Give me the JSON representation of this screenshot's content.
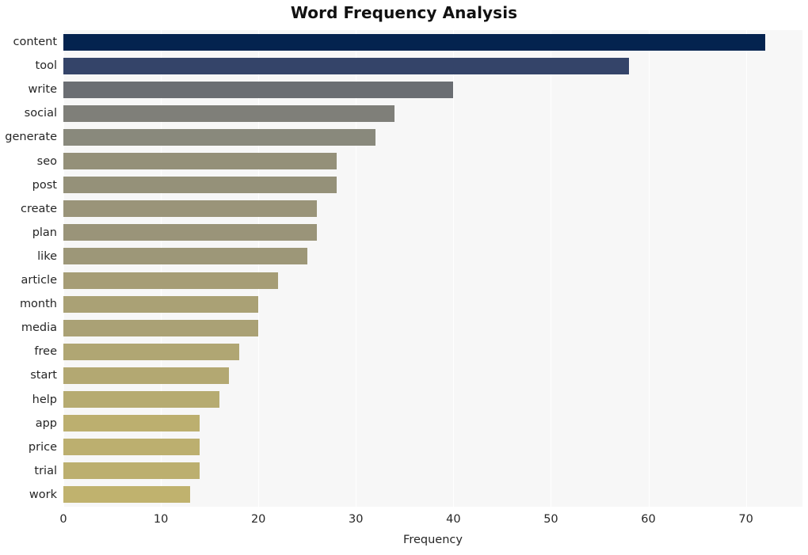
{
  "chart_data": {
    "type": "bar",
    "orientation": "horizontal",
    "title": "Word Frequency Analysis",
    "xlabel": "Frequency",
    "ylabel": "",
    "xlim": [
      0,
      75.8
    ],
    "xticks": [
      0,
      10,
      20,
      30,
      40,
      50,
      60,
      70
    ],
    "xtick_labels": [
      "0",
      "10",
      "20",
      "30",
      "40",
      "50",
      "60",
      "70"
    ],
    "grid": "vertical-only",
    "legend": "none",
    "plot_background": "#f7f7f7",
    "figure_background": "#ffffff",
    "gridline_color": "#ffffff",
    "categories": [
      "content",
      "tool",
      "write",
      "social",
      "generate",
      "seo",
      "post",
      "create",
      "plan",
      "like",
      "article",
      "month",
      "media",
      "free",
      "start",
      "help",
      "app",
      "price",
      "trial",
      "work"
    ],
    "values": [
      72,
      58,
      40,
      34,
      32,
      28,
      28,
      26,
      26,
      25,
      22,
      20,
      20,
      18,
      17,
      16,
      14,
      14,
      14,
      13
    ],
    "bar_colors": [
      "#04234f",
      "#344469",
      "#6b6e73",
      "#7f7f79",
      "#89897c",
      "#949079",
      "#959179",
      "#9a9479",
      "#9a9479",
      "#9d9778",
      "#a69d76",
      "#aaa175",
      "#aaa175",
      "#b0a673",
      "#b3a872",
      "#b6ab71",
      "#bcaf6f",
      "#bcaf6f",
      "#bcaf6f",
      "#c0b26e"
    ],
    "series": [
      {
        "name": "Frequency",
        "points": [
          {
            "label": "content",
            "value": 72,
            "color": "#04234f"
          },
          {
            "label": "tool",
            "value": 58,
            "color": "#344469"
          },
          {
            "label": "write",
            "value": 40,
            "color": "#6b6e73"
          },
          {
            "label": "social",
            "value": 34,
            "color": "#7f7f79"
          },
          {
            "label": "generate",
            "value": 32,
            "color": "#89897c"
          },
          {
            "label": "seo",
            "value": 28,
            "color": "#949079"
          },
          {
            "label": "post",
            "value": 28,
            "color": "#959179"
          },
          {
            "label": "create",
            "value": 26,
            "color": "#9a9479"
          },
          {
            "label": "plan",
            "value": 26,
            "color": "#9a9479"
          },
          {
            "label": "like",
            "value": 25,
            "color": "#9d9778"
          },
          {
            "label": "article",
            "value": 22,
            "color": "#a69d76"
          },
          {
            "label": "month",
            "value": 20,
            "color": "#aaa175"
          },
          {
            "label": "media",
            "value": 20,
            "color": "#aaa175"
          },
          {
            "label": "free",
            "value": 18,
            "color": "#b0a673"
          },
          {
            "label": "start",
            "value": 17,
            "color": "#b3a872"
          },
          {
            "label": "help",
            "value": 16,
            "color": "#b6ab71"
          },
          {
            "label": "app",
            "value": 14,
            "color": "#bcaf6f"
          },
          {
            "label": "price",
            "value": 14,
            "color": "#bcaf6f"
          },
          {
            "label": "trial",
            "value": 14,
            "color": "#bcaf6f"
          },
          {
            "label": "work",
            "value": 13,
            "color": "#c0b26e"
          }
        ]
      }
    ]
  }
}
